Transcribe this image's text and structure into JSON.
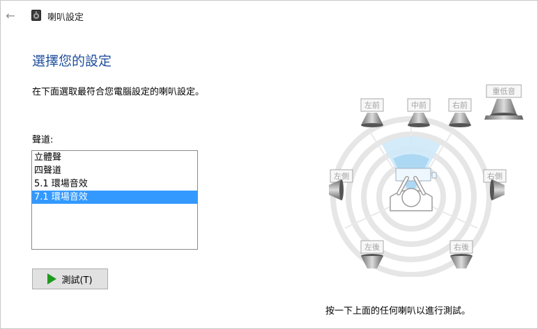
{
  "window": {
    "title": "喇叭設定"
  },
  "page": {
    "heading": "選擇您的設定",
    "instruction": "在下面選取最符合您電腦設定的喇叭設定。",
    "channels_label": "聲道:",
    "hint": "按一下上面的任何喇叭以進行測試。"
  },
  "channels": {
    "items": [
      {
        "label": "立體聲",
        "selected": false
      },
      {
        "label": "四聲道",
        "selected": false
      },
      {
        "label": "5.1 環場音效",
        "selected": false
      },
      {
        "label": "7.1 環場音效",
        "selected": true
      }
    ]
  },
  "test_button": {
    "label": "測試(T)"
  },
  "speakers": {
    "front_left": "左前",
    "center": "中前",
    "front_right": "右前",
    "subwoofer": "重低音",
    "side_left": "左側",
    "side_right": "右側",
    "rear_left": "左後",
    "rear_right": "右後"
  },
  "colors": {
    "heading": "#1e4e9c",
    "selection": "#3399ff",
    "play_icon": "#1f9a1f"
  }
}
